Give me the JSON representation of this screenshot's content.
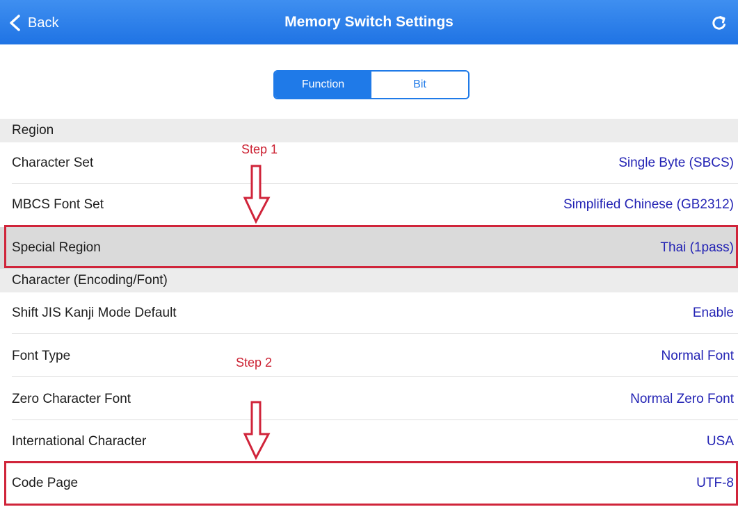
{
  "nav": {
    "back_label": "Back",
    "title": "Memory Switch Settings",
    "back_icon": "chevron-left-icon",
    "refresh_icon": "refresh-icon"
  },
  "segmented": {
    "function_label": "Function",
    "bit_label": "Bit",
    "selected": "Function"
  },
  "sections": {
    "region": {
      "header": "Region",
      "rows": [
        {
          "label": "Character Set",
          "value": "Single Byte (SBCS)"
        },
        {
          "label": "MBCS Font Set",
          "value": "Simplified Chinese (GB2312)"
        },
        {
          "label": "Special Region",
          "value": "Thai (1pass)"
        }
      ]
    },
    "character": {
      "header": "Character (Encoding/Font)",
      "rows": [
        {
          "label": "Shift JIS Kanji Mode Default",
          "value": "Enable"
        },
        {
          "label": "Font Type",
          "value": "Normal Font"
        },
        {
          "label": "Zero Character Font",
          "value": "Normal Zero Font"
        },
        {
          "label": "International Character",
          "value": "USA"
        },
        {
          "label": "Code Page",
          "value": "UTF-8"
        }
      ]
    }
  },
  "annotations": {
    "step1": "Step 1",
    "step2": "Step 2",
    "arrow_color": "#d0243a"
  },
  "colors": {
    "nav_bar": "#2a7de9",
    "accent": "#1f7ae8",
    "value_text": "#2323b4",
    "highlight": "#d0243a"
  }
}
